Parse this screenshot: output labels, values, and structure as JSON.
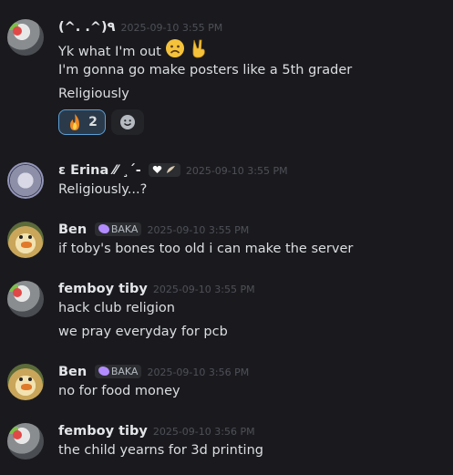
{
  "messages": [
    {
      "name": "(^. .^)٩",
      "time": "2025-09-10 3:55 PM",
      "lines": [
        "Yk what I'm out",
        "I'm gonna go make posters like a 5th grader",
        "Religiously"
      ],
      "reaction": {
        "emoji": "fire-icon",
        "count": "2"
      }
    },
    {
      "name": "ε  Erina ⁄⁄ ¸´-",
      "time": "2025-09-10 3:55 PM",
      "lines": [
        "Religiously...?"
      ]
    },
    {
      "name": "Ben",
      "tag": "BAKA",
      "time": "2025-09-10 3:55 PM",
      "lines": [
        "if toby's bones too old i can make the server"
      ]
    },
    {
      "name": "femboy tiby",
      "time": "2025-09-10 3:55 PM",
      "lines": [
        "hack club religion",
        "we pray everyday for pcb"
      ]
    },
    {
      "name": "Ben",
      "tag": "BAKA",
      "time": "2025-09-10 3:56 PM",
      "lines": [
        "no for food money"
      ]
    },
    {
      "name": "femboy tiby",
      "time": "2025-09-10 3:56 PM",
      "lines": [
        "the child yearns for 3d printing"
      ]
    }
  ],
  "colors": {
    "background": "#1a1a1e",
    "reaction_border": "#5a9fd6",
    "tag_gem": "#b28cff"
  }
}
